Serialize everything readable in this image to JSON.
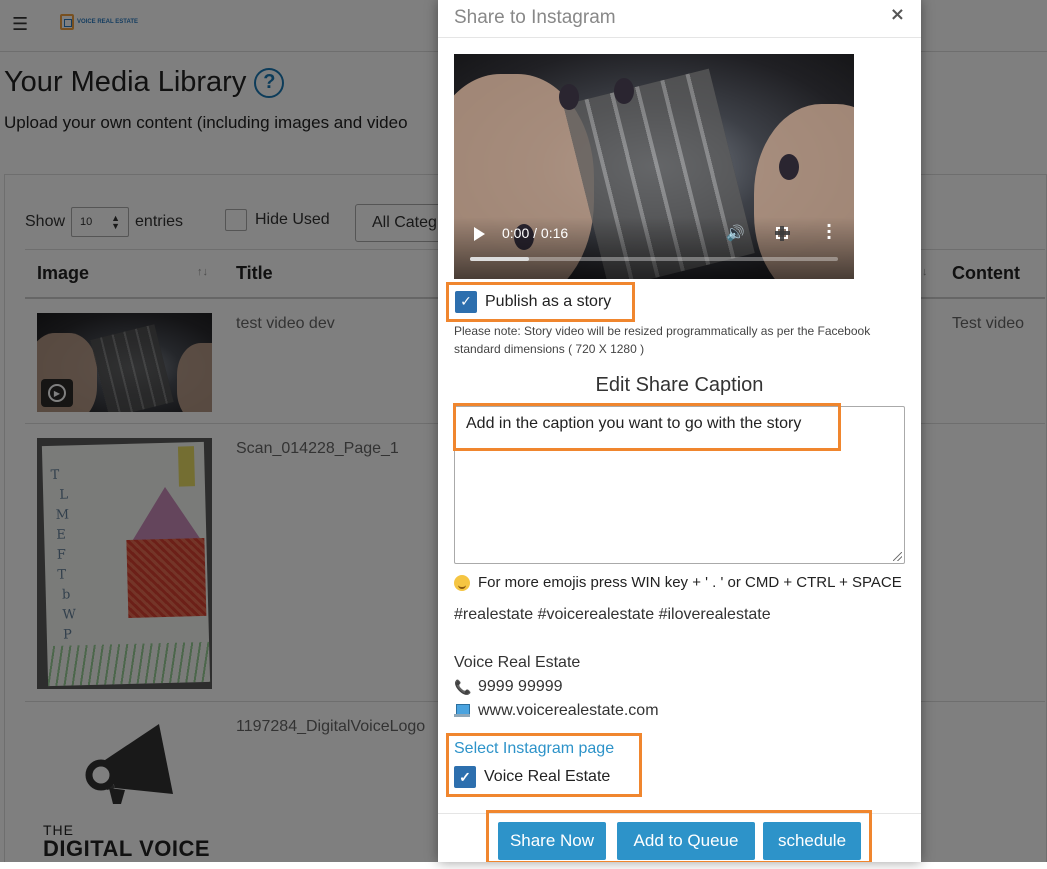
{
  "topbar": {
    "menu_icon": "hamburger-icon",
    "logo_text": "VOICE REAL ESTATE"
  },
  "library": {
    "title": "Your Media Library",
    "help_icon": "question-circle-icon",
    "subtitle": "Upload your own content (including images and video",
    "show_label": "Show",
    "entries_value": "10",
    "entries_label": "entries",
    "hide_used_label": "Hide Used",
    "category_value": "All Categ",
    "columns": [
      "Image",
      "Title",
      "Content"
    ],
    "rows": [
      {
        "title": "test video dev",
        "content": "Test video"
      },
      {
        "title": "Scan_014228_Page_1",
        "content": ""
      },
      {
        "title": "1197284_DigitalVoiceLogo",
        "content": ""
      }
    ],
    "logo_the": "THE",
    "logo_name": "DIGITAL VOICE"
  },
  "modal": {
    "title": "Share to Instagram",
    "close_icon": "close-icon",
    "video": {
      "time": "0:00 / 0:16",
      "progress": 0.16
    },
    "publish_story_label": "Publish as a story",
    "publish_story_checked": true,
    "note": "Please note: Story video will be resized programmatically as per the Facebook standard dimensions ( 720 X 1280 )",
    "caption_heading": "Edit Share Caption",
    "caption_text": "Add in the caption you want to go with the story",
    "emoji_tip": "For more emojis press WIN key + ' . ' or CMD + CTRL + SPACE",
    "hashtags": "#realestate #voicerealestate #iloverealestate",
    "contact_name": "Voice Real Estate",
    "contact_phone": "9999 99999",
    "contact_website": "www.voicerealestate.com",
    "select_page_label": "Select Instagram page",
    "page_option": "Voice Real Estate",
    "page_option_checked": true,
    "buttons": {
      "share_now": "Share Now",
      "add_to_queue": "Add to Queue",
      "schedule": "schedule"
    }
  },
  "colors": {
    "accent": "#2d93c9",
    "highlight": "#f0862e",
    "checkbox": "#2d6fae"
  }
}
